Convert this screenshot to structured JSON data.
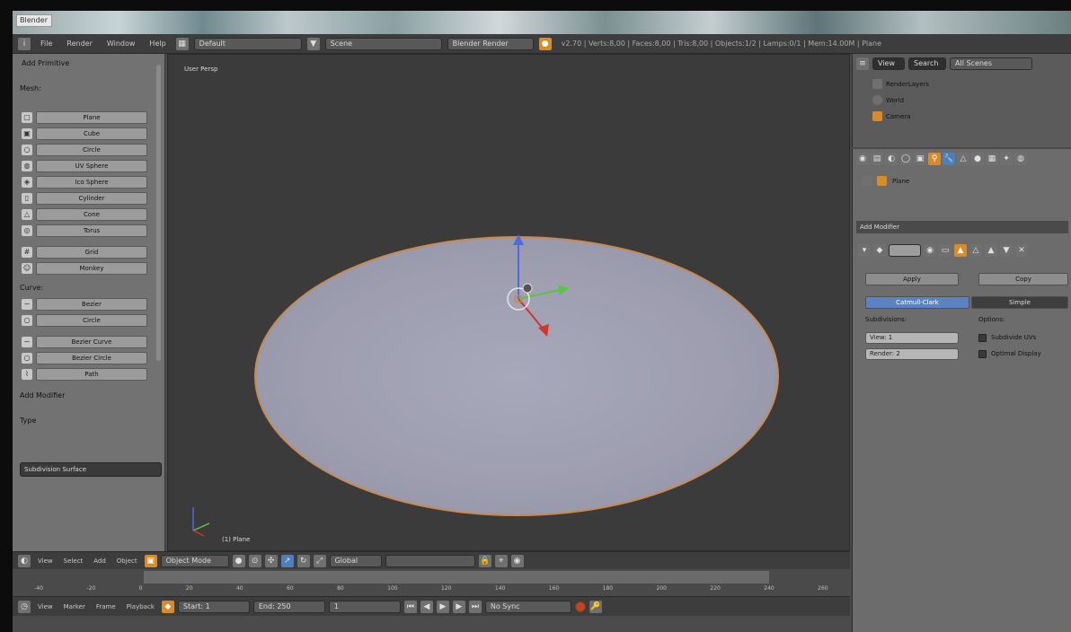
{
  "window": {
    "app_tag": "Blender"
  },
  "menubar": {
    "items": [
      "File",
      "Render",
      "Window",
      "Help"
    ],
    "screen_layout": "Default",
    "scene": "Scene",
    "render_engine": "Blender Render",
    "stats": "v2.70 | Verts:8,00 | Faces:8,00 | Tris:8,00 | Objects:1/2 | Lamps:0/1 | Mem:14.00M | Plane"
  },
  "shelf": {
    "section_add": "Add Primitive",
    "mesh_heading": "Mesh:",
    "mesh_buttons": [
      "Plane",
      "Cube",
      "Circle",
      "UV Sphere",
      "Ico Sphere",
      "Cylinder",
      "Cone",
      "Torus"
    ],
    "extra_buttons": [
      "Grid",
      "Monkey"
    ],
    "curve_heading": "Curve:",
    "curve_buttons": [
      "Bezier",
      "Circle"
    ],
    "other_buttons": [
      "Bezier Curve",
      "Bezier Circle",
      "Path"
    ],
    "modifier_heading": "Add Modifier",
    "type_label": "Type",
    "modifier_value": "Subdivision Surface"
  },
  "viewport": {
    "top_label": "User Persp",
    "bottom_label": "(1) Plane"
  },
  "outliner": {
    "menu": [
      "View",
      "Search",
      "All Scenes"
    ],
    "rows": [
      "RenderLayers",
      "World",
      "Camera"
    ]
  },
  "properties": {
    "object_name": "Plane",
    "section_title": "Add Modifier",
    "apply_label": "Apply",
    "copy_label": "Copy",
    "tab_catmull": "Catmull-Clark",
    "tab_simple": "Simple",
    "subdivisions_label": "Subdivisions:",
    "options_label": "Options:",
    "view_field": "View: 1",
    "render_field": "Render: 2",
    "subdivide_uvs": "Subdivide UVs",
    "optimal_display": "Optimal Display"
  },
  "viewport_header": {
    "items": [
      "View",
      "Select",
      "Add",
      "Object"
    ],
    "mode": "Object Mode",
    "pivot": "Global"
  },
  "timeline": {
    "ticks": [
      "-40",
      "-20",
      "0",
      "20",
      "40",
      "60",
      "80",
      "100",
      "120",
      "140",
      "160",
      "180",
      "200",
      "220",
      "240",
      "260"
    ]
  },
  "timebar": {
    "items": [
      "View",
      "Marker",
      "Frame",
      "Playback"
    ],
    "start": "Start: 1",
    "end": "End: 250",
    "current": "1",
    "sync": "No Sync"
  }
}
